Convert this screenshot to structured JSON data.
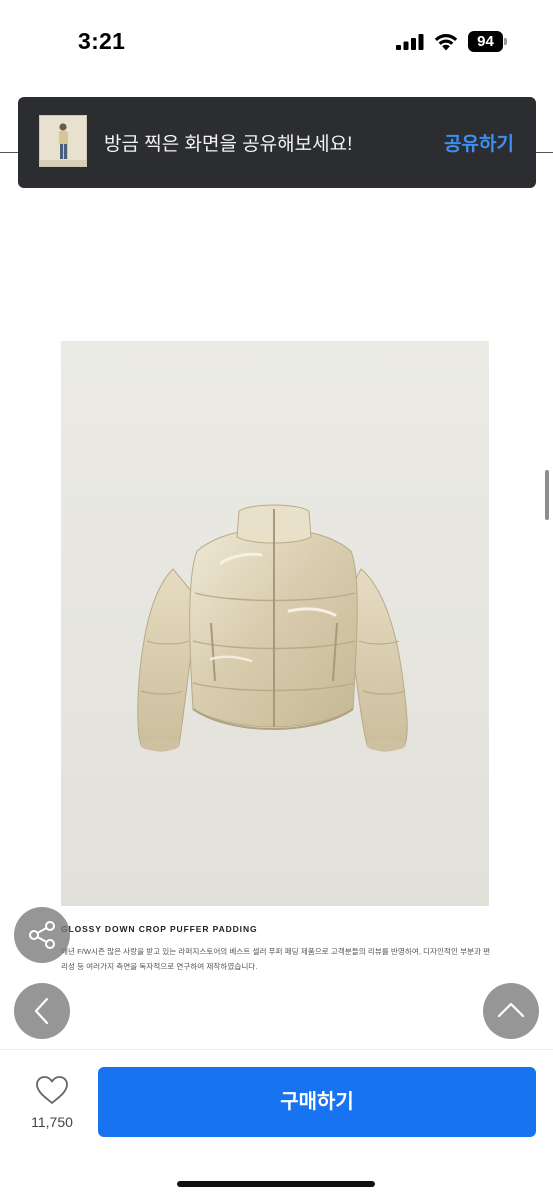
{
  "status_bar": {
    "time": "3:21",
    "battery": "94",
    "icons": [
      "signal-icon",
      "wifi-icon",
      "battery-icon"
    ]
  },
  "toast": {
    "message": "방금 찍은 화면을 공유해보세요!",
    "action_label": "공유하기",
    "action_color": "#3d8ef0"
  },
  "product": {
    "title": "GLOSSY DOWN CROP PUFFER PADDING",
    "description": "매년 F/W시즌 많은 사랑을 받고 있는 라퍼지스토어의 베스트 셀러 푸퍼 패딩 제품으로 고객분들의 리뷰를 반영하여, 디자인적인 부분과 편리성 등 여러가지 측면을 독자적으로 연구하여 제작하였습니다."
  },
  "floating_buttons": {
    "share": "share-icon",
    "back": "chevron-left-icon",
    "top": "chevron-up-icon"
  },
  "bottom_bar": {
    "like_count": "11,750",
    "buy_label": "구매하기",
    "buy_color": "#1873f0"
  }
}
